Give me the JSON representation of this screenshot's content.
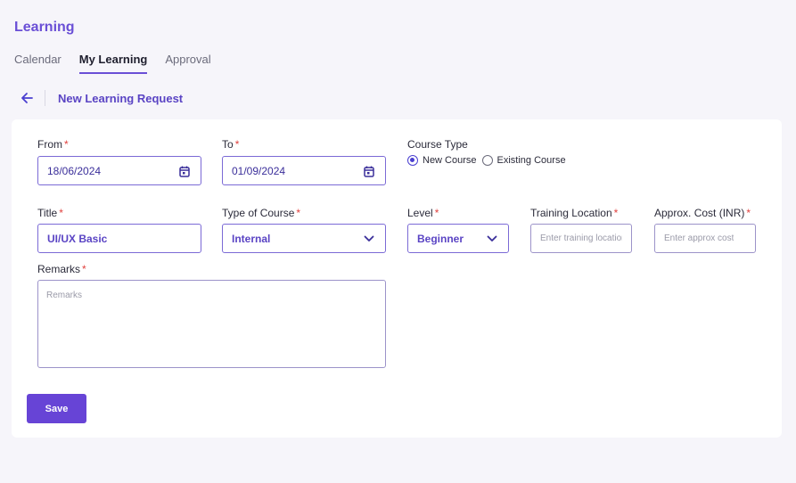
{
  "page": {
    "title": "Learning"
  },
  "tabs": [
    {
      "label": "Calendar",
      "active": false
    },
    {
      "label": "My Learning",
      "active": true
    },
    {
      "label": "Approval",
      "active": false
    }
  ],
  "breadcrumb": {
    "title": "New Learning Request"
  },
  "form": {
    "from": {
      "label": "From",
      "value": "18/06/2024"
    },
    "to": {
      "label": "To",
      "value": "01/09/2024"
    },
    "course_type": {
      "label": "Course Type",
      "options": [
        {
          "label": "New Course",
          "selected": true
        },
        {
          "label": "Existing Course",
          "selected": false
        }
      ]
    },
    "title": {
      "label": "Title",
      "value": "UI/UX Basic"
    },
    "type_of_course": {
      "label": "Type of Course",
      "value": "Internal"
    },
    "level": {
      "label": "Level",
      "value": "Beginner"
    },
    "training_location": {
      "label": "Training Location",
      "placeholder": "Enter training location"
    },
    "approx_cost": {
      "label": "Approx. Cost (INR)",
      "placeholder": "Enter approx cost"
    },
    "remarks": {
      "label": "Remarks",
      "placeholder": "Remarks"
    },
    "required_mark": "*"
  },
  "actions": {
    "save_label": "Save"
  },
  "colors": {
    "accent": "#6744d6",
    "required": "#e0413e",
    "background": "#f6f5fa"
  },
  "icons": [
    "back-arrow-icon",
    "calendar-icon",
    "chevron-down-icon"
  ]
}
